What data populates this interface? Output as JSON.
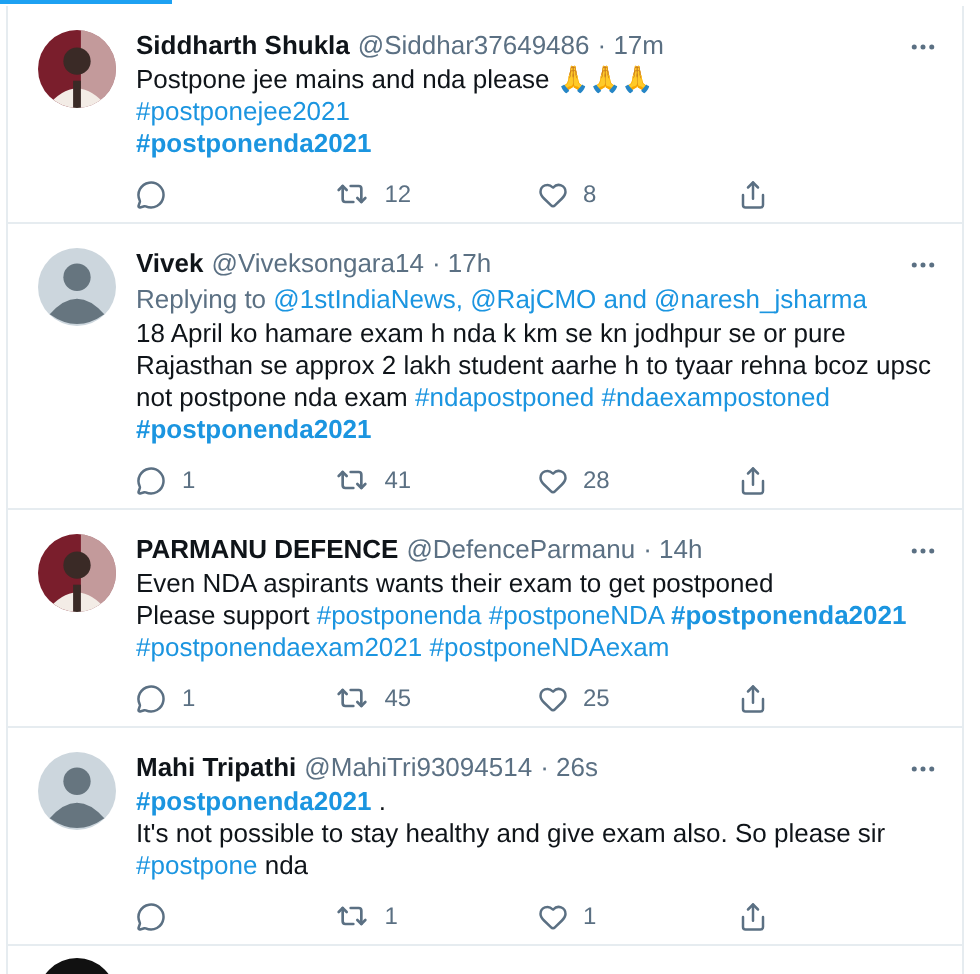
{
  "tweets": [
    {
      "name": "Siddharth Shukla",
      "handle": "@Siddhar37649486",
      "time": "· 17m",
      "avatar": {
        "kind": "picture"
      },
      "lines": [
        [
          {
            "kind": "text",
            "text": "Postpone jee mains and nda please 🙏🙏🙏"
          }
        ],
        [
          {
            "kind": "hashtag",
            "text": "#postponejee2021",
            "bold": false
          }
        ],
        [
          {
            "kind": "hashtag",
            "text": "#postponenda2021",
            "bold": true
          }
        ]
      ],
      "retweets": "12",
      "likes": "8"
    },
    {
      "name": "Vivek",
      "handle": "@Viveksongara14",
      "time": "· 17h",
      "avatar": {
        "kind": "default"
      },
      "reply_to": [
        {
          "kind": "text",
          "text": "Replying to "
        },
        {
          "kind": "mention",
          "text": "@1stIndiaNews, @RajCMO and @naresh_jsharma"
        }
      ],
      "lines": [
        [
          {
            "kind": "text",
            "text": "18 April ko hamare exam h nda k km se kn jodhpur se or pure Rajasthan se approx 2 lakh student aarhe h to tyaar rehna bcoz upsc not postpone nda exam "
          },
          {
            "kind": "hashtag",
            "text": "#ndapostponed",
            "bold": false
          },
          {
            "kind": "hashtag",
            "text": "#ndaexampostoned",
            "bold": false
          },
          {
            "kind": "hashtag",
            "text": "#postponenda2021",
            "bold": true
          }
        ]
      ],
      "replies": "1",
      "retweets": "41",
      "likes": "28"
    },
    {
      "name": "PARMANU DEFENCE",
      "handle": "@DefenceParmanu",
      "time": "· 14h",
      "avatar": {
        "kind": "picture"
      },
      "lines": [
        [
          {
            "kind": "text",
            "text": "Even NDA aspirants wants their exam to get postponed"
          }
        ],
        [
          {
            "kind": "text",
            "text": "Please support "
          },
          {
            "kind": "hashtag",
            "text": "#postponenda",
            "bold": false
          },
          {
            "kind": "hashtag",
            "text": "#postponeNDA",
            "bold": false
          },
          {
            "kind": "hashtag",
            "text": "#postponenda2021",
            "bold": true
          },
          {
            "kind": "hashtag",
            "text": "#postponendaexam2021",
            "bold": false
          },
          {
            "kind": "hashtag",
            "text": "#postponeNDAexam",
            "bold": false
          }
        ]
      ],
      "replies": "1",
      "retweets": "45",
      "likes": "25"
    },
    {
      "name": "Mahi Tripathi",
      "handle": "@MahiTri93094514",
      "time": "· 26s",
      "avatar": {
        "kind": "default"
      },
      "lines": [
        [
          {
            "kind": "hashtag",
            "text": "#postponenda2021",
            "bold": true
          },
          {
            "kind": "text",
            "text": " ."
          }
        ],
        [
          {
            "kind": "text",
            "text": "It's not possible to stay healthy and give exam also. So please sir "
          },
          {
            "kind": "hashtag",
            "text": "#postpone",
            "bold": false
          },
          {
            "kind": "text",
            "text": " nda"
          }
        ]
      ],
      "retweets": "1",
      "likes": "1"
    }
  ],
  "next_tweet": {
    "avatar": {
      "kind": "dark"
    }
  }
}
